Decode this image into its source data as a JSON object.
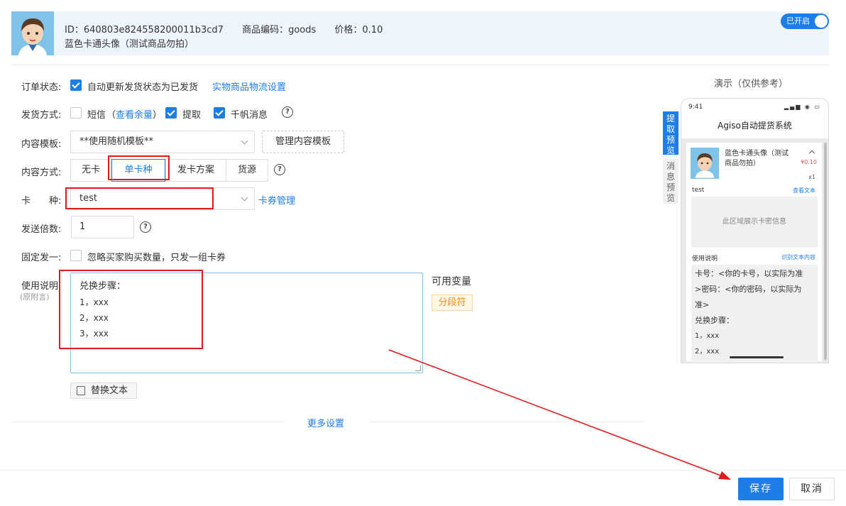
{
  "header": {
    "id_text": "ID：640803e824558200011b3cd7",
    "code_text": "商品编码：goods",
    "price_text": "价格：0.10",
    "product_name": "蓝色卡通头像（测试商品勿拍）",
    "toggle_label": "已开启"
  },
  "form": {
    "order_status": {
      "label": "订单状态:",
      "checkbox_label": "自动更新发货状态为已发货",
      "link": "实物商品物流设置"
    },
    "delivery": {
      "label": "发货方式:",
      "sms": "短信",
      "sms_link_open": "（",
      "sms_link": "查看余量",
      "sms_link_close": "）",
      "pickup": "提取",
      "qianniu": "千帆消息"
    },
    "template": {
      "label": "内容模板:",
      "selected": "**使用随机模板**",
      "manage_button": "管理内容模板"
    },
    "content_mode": {
      "label": "内容方式:",
      "options": [
        "无卡",
        "单卡种",
        "发卡方案",
        "货源"
      ],
      "active_index": 1
    },
    "card_type": {
      "label": "卡　　种:",
      "selected": "test",
      "manage_link": "卡券管理"
    },
    "multiplier": {
      "label": "发送倍数:",
      "value": "1"
    },
    "fixed_one": {
      "label": "固定发一:",
      "checkbox_label": "忽略买家购买数量，只发一组卡券"
    },
    "instructions": {
      "label": "使用说明:",
      "sublabel": "(原附言)",
      "lines": [
        "兑换步骤：",
        "1，xxx",
        "2，xxx",
        "3，xxx"
      ],
      "variables_title": "可用变量",
      "variable_tag": "分段符",
      "replace_button": "替换文本"
    },
    "more_settings": "更多设置"
  },
  "footer": {
    "save": "保存",
    "cancel": "取消"
  },
  "preview": {
    "title": "演示（仅供参考）",
    "tab_pickup": "提取预览",
    "tab_message": "消息预览",
    "status_time": "9:41",
    "nav_title": "Agiso自动提货系统",
    "product_name": "蓝色卡通头像（测试商品勿拍）",
    "price": "¥0.10",
    "qty": "x1",
    "card_name": "test",
    "view_text_link": "查看文本",
    "card_area_text": "此区域展示卡密信息",
    "usage_title": "使用说明",
    "usage_link": "识别文本内容",
    "usage_lines": [
      "卡号：<你的卡号，以实际为准",
      ">密码：<你的密码，以实际为",
      "准>",
      "兑换步骤：",
      "1，xxx",
      "2，xxx"
    ]
  },
  "colors": {
    "accent": "#1d7ee8",
    "annotation_red": "#e01a1a",
    "tag_orange": "#fa8c16"
  }
}
